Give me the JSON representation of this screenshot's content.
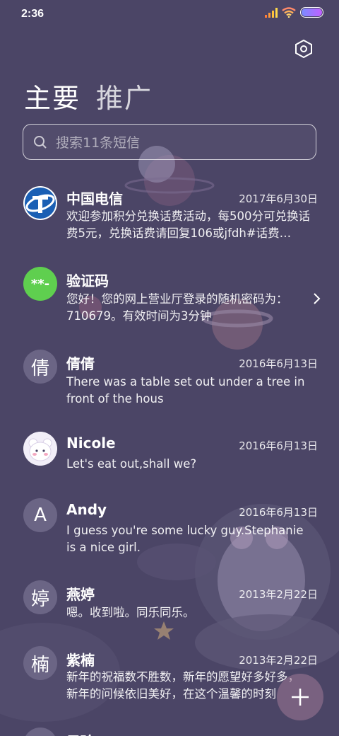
{
  "status_bar": {
    "time": "2:36"
  },
  "header": {
    "settings_icon": "settings-hexagon-icon"
  },
  "tabs": [
    {
      "label": "主要",
      "active": true
    },
    {
      "label": "推广",
      "active": false
    }
  ],
  "search": {
    "placeholder": "搜索11条短信",
    "icon": "search-icon"
  },
  "messages": [
    {
      "sender": "中国电信",
      "date": "2017年6月30日",
      "preview": "欢迎参加积分兑换话费活动，每500分可兑换话费5元，兑换话费请回复106或jfdh#话费…",
      "avatar": "china-telecom-logo"
    },
    {
      "sender": "验证码",
      "date": "",
      "preview": "您好！您的网上营业厅登录的随机密码为：710679。有效时间为3分钟",
      "avatar_text": "**-"
    },
    {
      "sender": "倩倩",
      "date": "2016年6月13日",
      "preview": "There was a table set out under a tree in front of the hous",
      "avatar_text": "倩"
    },
    {
      "sender": "Nicole",
      "date": "2016年6月13日",
      "preview": "Let's eat out,shall we?",
      "avatar": "bear-photo"
    },
    {
      "sender": "Andy",
      "date": "2016年6月13日",
      "preview": "I guess you're some lucky guy.Stephanie is a nice girl.",
      "avatar_text": "A"
    },
    {
      "sender": "燕婷",
      "date": "2013年2月22日",
      "preview": "嗯。收到啦。同乐同乐。",
      "avatar_text": "婷"
    },
    {
      "sender": "紫楠",
      "date": "2013年2月22日",
      "preview": "新年的祝福数不胜数，新年的愿望好多好多，新年的问候依旧美好，在这个温馨的时刻",
      "avatar_text": "楠"
    },
    {
      "sender": "子玲",
      "date": "",
      "preview": "",
      "avatar_text": ""
    }
  ],
  "fab": {
    "icon": "plus-icon"
  },
  "colors": {
    "background": "#4b4566",
    "verification_avatar": "#5fcf4f",
    "telecom_blue": "#1a5fb4"
  }
}
